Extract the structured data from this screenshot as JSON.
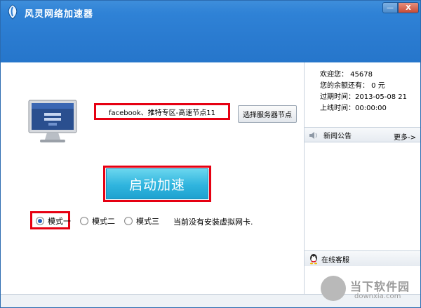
{
  "window": {
    "title": "风灵网络加速器",
    "minimize_label": "—",
    "close_label": "X"
  },
  "server": {
    "current_node": "facebook、推特专区-高速节点11",
    "select_button": "选择服务器节点"
  },
  "accelerate": {
    "start_button": "启动加速"
  },
  "modes": [
    {
      "label": "模式一",
      "checked": true
    },
    {
      "label": "模式二",
      "checked": false
    },
    {
      "label": "模式三",
      "checked": false
    }
  ],
  "status": {
    "message": "当前没有安装虚拟网卡."
  },
  "account": {
    "welcome": "欢迎您： 45678",
    "balance": "您的余额还有： 0 元",
    "expiry": "过期时间：2013-05-08 21",
    "online_time": "上线时间：00:00:00"
  },
  "news": {
    "title": "新闻公告",
    "more": "更多->"
  },
  "service": {
    "label": "在线客服"
  },
  "watermark": {
    "name": "当下软件园",
    "domain": "downxia.com"
  },
  "colors": {
    "titlebar": "#2a7bd0",
    "highlight": "#e60012",
    "start_button": "#2fb4de"
  }
}
